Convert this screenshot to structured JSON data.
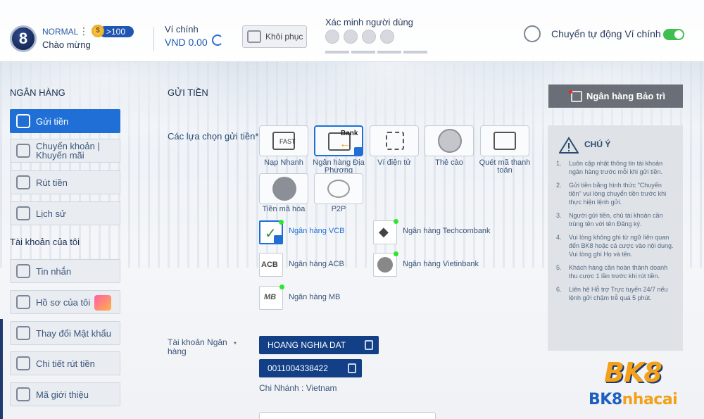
{
  "header": {
    "avatar_text": "8",
    "level": "NORMAL",
    "badge": ">100",
    "welcome": "Chào mừng",
    "wallet_label": "Ví chính",
    "wallet_value": "VND 0.00",
    "restore_label": "Khôi phục",
    "verify_label": "Xác minh người dùng",
    "auto_transfer_label": "Chuyển tự động Ví chính",
    "auto_transfer_on": true
  },
  "sidebar": {
    "bank_title": "NGÂN HÀNG",
    "bank_items": [
      {
        "label": "Gửi tiền",
        "icon": "deposit-icon"
      },
      {
        "label": "Chuyển khoản | Khuyến mãi",
        "icon": "transfer-icon"
      },
      {
        "label": "Rút tiền",
        "icon": "withdraw-icon"
      },
      {
        "label": "Lịch sử",
        "icon": "history-icon"
      }
    ],
    "account_title": "Tài khoản của tôi",
    "account_items": [
      {
        "label": "Tin nhắn",
        "icon": "mail-icon"
      },
      {
        "label": "Hồ sơ của tôi",
        "icon": "profile-icon"
      },
      {
        "label": "Thay đổi Mật khẩu",
        "icon": "password-icon"
      },
      {
        "label": "Chi tiết rút tiền",
        "icon": "bank-details-icon"
      },
      {
        "label": "Mã giới thiệu",
        "icon": "referral-icon"
      }
    ]
  },
  "main": {
    "title": "GỬI TIỀN",
    "options_label": "Các lựa chọn gửi tiền*",
    "options": [
      {
        "label": "Nạp Nhanh",
        "icon": "fast-deposit-icon",
        "glyph": "FAST"
      },
      {
        "label": "Ngân hàng Địa Phương",
        "icon": "local-bank-icon",
        "glyph": "Bank"
      },
      {
        "label": "Ví điện tử",
        "icon": "qr-wallet-icon",
        "glyph": ""
      },
      {
        "label": "Thẻ cào",
        "icon": "scratch-card-icon",
        "glyph": ""
      },
      {
        "label": "Quét mã thanh toán",
        "icon": "scan-pay-icon",
        "glyph": ""
      },
      {
        "label": "Tiền mã hóa",
        "icon": "crypto-icon",
        "glyph": ""
      },
      {
        "label": "P2P",
        "icon": "p2p-icon",
        "glyph": ""
      }
    ],
    "banks": [
      {
        "label": "Ngân hàng VCB",
        "glyph": ""
      },
      {
        "label": "Ngân hàng Techcombank",
        "glyph": ""
      },
      {
        "label": "Ngân hàng ACB",
        "glyph": "ACB"
      },
      {
        "label": "Ngân hàng Vietinbank",
        "glyph": ""
      },
      {
        "label": "Ngân hàng MB",
        "glyph": "MB"
      }
    ],
    "account_label": "Tài khoản Ngân hàng",
    "account_star": "*",
    "account_name": "HOANG NGHIA DAT",
    "account_number": "0011004338422",
    "branch": "Chi Nhánh : Vietnam"
  },
  "right": {
    "maintenance_btn": "Ngân hàng Bảo trì",
    "notice_title": "CHÚ Ý",
    "notes": [
      "Luôn cập nhật thông tin tài khoản ngân hàng trước mỗi khi gửi tiền.",
      "Gửi tiền bằng hình thức \"Chuyển tiền\" vui lòng chuyển tiền trước khi thực hiện lệnh gửi.",
      "Người gửi tiền, chủ tài khoản cần trùng tên với tên Đăng ký.",
      "Vui lòng không ghi từ ngữ liên quan đến BK8 hoặc cá cược vào nội dung. Vui lòng ghi Họ và tên.",
      "Khách hàng cần hoàn thành doanh thu cược 1 lần trước khi rút tiền.",
      "Liên hệ Hỗ trợ Trực tuyến 24/7 nếu lệnh gửi chậm trễ quá 5 phút."
    ]
  },
  "logo": {
    "top": "BK8",
    "bottom_a": "BK8",
    "bottom_b": "nhacai"
  }
}
